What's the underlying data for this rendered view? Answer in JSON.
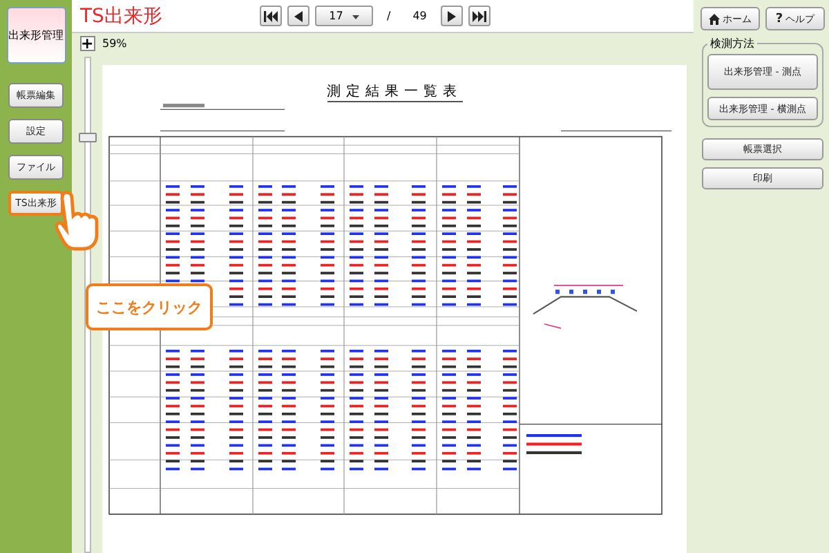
{
  "sidebar": {
    "header": "出来形管理",
    "items": [
      {
        "label": "帳票編集",
        "highlighted": false
      },
      {
        "label": "設定",
        "highlighted": false
      },
      {
        "label": "ファイル",
        "highlighted": false
      },
      {
        "label": "TS出来形",
        "highlighted": true
      }
    ]
  },
  "app_title": "TS出来形",
  "pager": {
    "page": "17",
    "separator": "/",
    "total": "49"
  },
  "zoom": {
    "plus": "+",
    "percent": "59%",
    "level": 0.85
  },
  "document": {
    "title": "測定結果一覧表"
  },
  "callout": {
    "text": "ここをクリック"
  },
  "right_panel": {
    "home": "ホーム",
    "help_mark": "?",
    "help": "ヘルプ",
    "group": {
      "title": "検測方法",
      "buttons": [
        "出来形管理 - 測点",
        "出来形管理 - 横測点"
      ]
    },
    "buttons": [
      "帳票選択",
      "印刷"
    ]
  }
}
